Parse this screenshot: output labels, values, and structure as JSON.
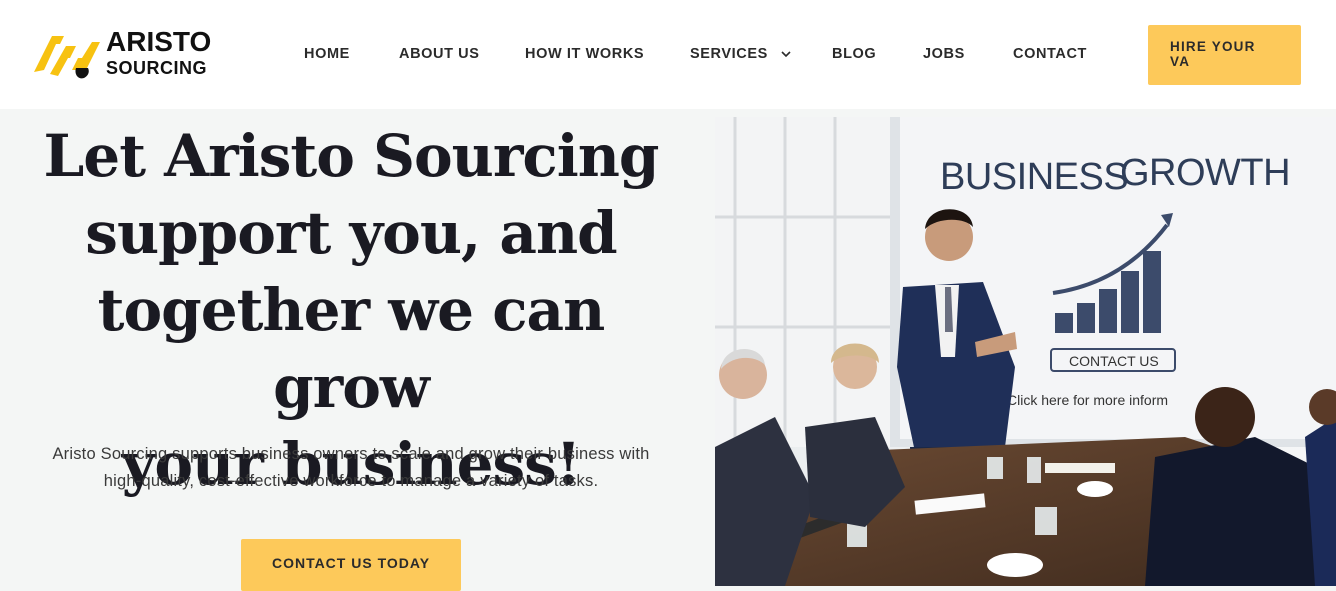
{
  "brand": {
    "line1": "ARISTO",
    "line2": "SOURCING"
  },
  "nav": {
    "home": "HOME",
    "about": "ABOUT US",
    "how": "HOW IT WORKS",
    "services": "SERVICES",
    "blog": "BLOG",
    "jobs": "JOBS",
    "contact": "CONTACT"
  },
  "header_cta": {
    "line1": "HIRE YOUR",
    "line2": "VA"
  },
  "hero": {
    "title_lines": [
      "Let Aristo Sourcing",
      "support you, and",
      "together we can grow",
      "your business!"
    ],
    "text_lines": [
      "Aristo Sourcing supports business owners to scale and grow their business with",
      "high-quality, cost-effective workforce to manage a variety of tasks."
    ],
    "cta": "CONTACT US TODAY"
  },
  "photo": {
    "board_title_1": "BUSINESS",
    "board_title_2": "GROWTH",
    "board_button": "CONTACT US",
    "board_caption": "Click here for more inform"
  },
  "colors": {
    "accent": "#fdc95a",
    "text_dark": "#1a1a22",
    "board_blue": "#3c4b6b"
  },
  "icons": {
    "logo": "aristo-logo-mark",
    "services_dropdown": "chevron-down-icon"
  }
}
